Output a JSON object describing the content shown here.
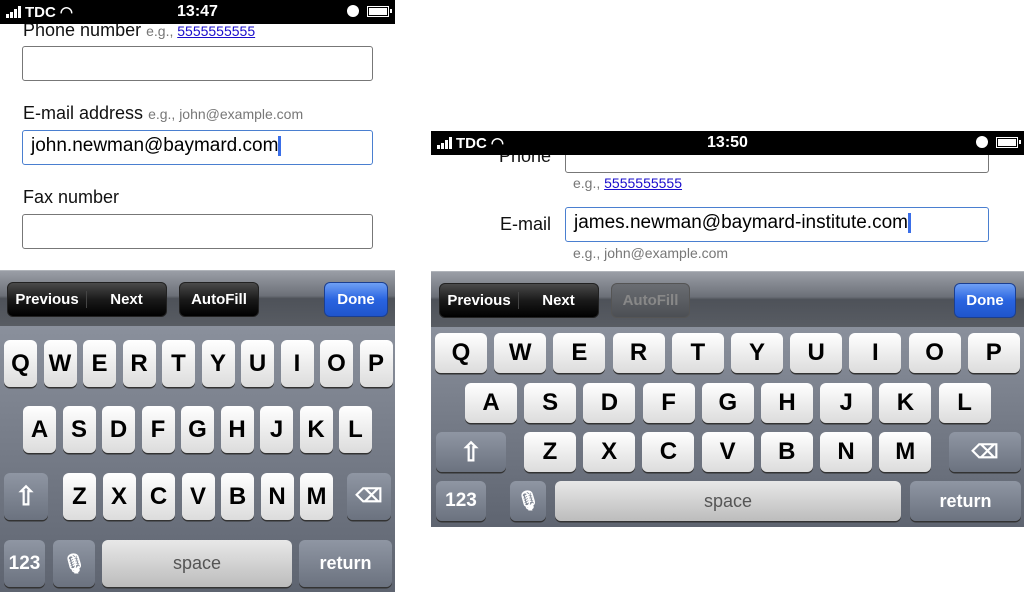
{
  "phones": [
    {
      "status": {
        "carrier": "TDC",
        "time": "13:47"
      },
      "form": {
        "phone_label": "Phone number",
        "phone_hint_prefix": "e.g.,",
        "phone_hint_link": "5555555555",
        "email_label": "E-mail address",
        "email_hint": "e.g., john@example.com",
        "email_value": "john.newman@baymard.com",
        "fax_label": "Fax number"
      },
      "toolbar": {
        "previous": "Previous",
        "next": "Next",
        "autofill": "AutoFill",
        "autofill_enabled": true,
        "done": "Done"
      }
    },
    {
      "status": {
        "carrier": "TDC",
        "time": "13:50"
      },
      "form": {
        "phone_label": "Phone",
        "phone_hint_prefix": "e.g.,",
        "phone_hint_link": "5555555555",
        "email_label": "E-mail",
        "email_value": "james.newman@baymard-institute.com",
        "email_hint": "e.g., john@example.com"
      },
      "toolbar": {
        "previous": "Previous",
        "next": "Next",
        "autofill": "AutoFill",
        "autofill_enabled": false,
        "done": "Done"
      }
    }
  ],
  "keyboard": {
    "rows": [
      [
        "Q",
        "W",
        "E",
        "R",
        "T",
        "Y",
        "U",
        "I",
        "O",
        "P"
      ],
      [
        "A",
        "S",
        "D",
        "F",
        "G",
        "H",
        "J",
        "K",
        "L"
      ],
      [
        "Z",
        "X",
        "C",
        "V",
        "B",
        "N",
        "M"
      ]
    ],
    "numbers": "123",
    "space": "space",
    "return": "return",
    "shift_icon": "shift-arrow",
    "delete_icon": "backspace",
    "mic_icon": "microphone"
  },
  "colors": {
    "done_button": "#2a64e0",
    "link": "#1a0dcc",
    "focus_border": "#4a7fd0"
  }
}
